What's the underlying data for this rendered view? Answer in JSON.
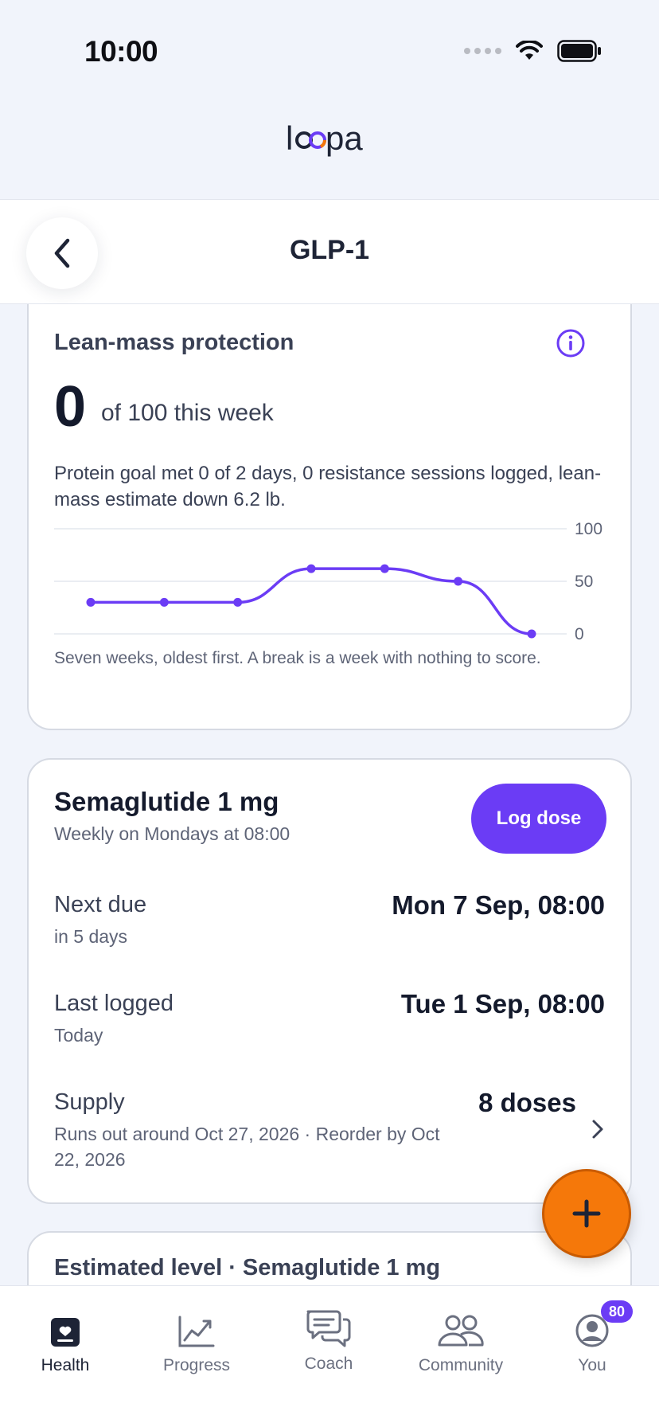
{
  "status_bar": {
    "time": "10:00"
  },
  "app": {
    "logo_text": "loopa"
  },
  "header": {
    "title": "GLP-1"
  },
  "lean_mass": {
    "title": "Lean-mass protection",
    "score": "0",
    "score_suffix": "of 100 this week",
    "description": "Protein goal met 0 of 2 days, 0 resistance sessions logged, lean-mass estimate down 6.2 lb.",
    "caption": "Seven weeks, oldest first. A break is a week with nothing to score.",
    "chart_data": {
      "type": "line",
      "x": [
        1,
        2,
        3,
        4,
        5,
        6,
        7
      ],
      "values": [
        30,
        30,
        30,
        62,
        62,
        50,
        0
      ],
      "ylim": [
        0,
        100
      ],
      "yticks": [
        "100",
        "50",
        "0"
      ],
      "grid": true,
      "color": "#6b3cf5"
    }
  },
  "medication": {
    "name": "Semaglutide 1 mg",
    "schedule": "Weekly on Mondays at 08:00",
    "log_button": "Log dose",
    "next_due_label": "Next due",
    "next_due_sub": "in 5 days",
    "next_due_value": "Mon 7 Sep, 08:00",
    "last_logged_label": "Last logged",
    "last_logged_sub": "Today",
    "last_logged_value": "Tue 1 Sep, 08:00",
    "supply_label": "Supply",
    "supply_sub": "Runs out around Oct 27, 2026 · Reorder by Oct 22, 2026",
    "supply_value": "8 doses"
  },
  "estimated_level": {
    "title": "Estimated level · Semaglutide 1 mg"
  },
  "tabs": [
    {
      "label": "Health",
      "icon": "health-icon",
      "active": true
    },
    {
      "label": "Progress",
      "icon": "chart-icon"
    },
    {
      "label": "Coach",
      "icon": "chat-icon"
    },
    {
      "label": "Community",
      "icon": "people-icon"
    },
    {
      "label": "You",
      "icon": "profile-icon",
      "badge": "80"
    }
  ],
  "colors": {
    "accent": "#6b3cf5",
    "fab": "#f5780a",
    "background": "#f1f4fb"
  }
}
